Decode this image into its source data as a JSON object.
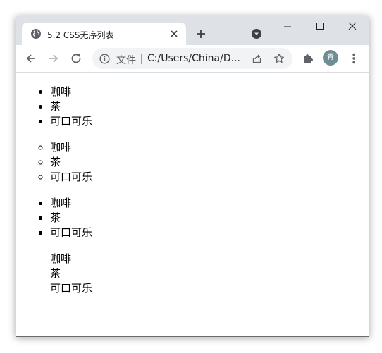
{
  "browser": {
    "tab": {
      "favicon": "globe-icon",
      "title": "5.2 CSS无序列表",
      "close_icon": "close-icon"
    },
    "new_tab_icon": "plus-icon",
    "tab_search_icon": "chevron-down-icon",
    "window_controls": [
      "minimize-icon",
      "maximize-icon",
      "close-icon"
    ],
    "toolbar": {
      "back_icon": "arrow-left-icon",
      "forward_icon": "arrow-right-icon",
      "reload_icon": "reload-icon",
      "site_info_icon": "info-icon",
      "site_label": "文件",
      "url": "C:/Users/China/D...",
      "share_icon": "share-icon",
      "bookmark_icon": "star-icon",
      "extensions_icon": "puzzle-icon",
      "profile_avatar": "青",
      "menu_icon": "kebab-menu-icon"
    }
  },
  "page": {
    "lists": [
      {
        "style": "disc",
        "items": [
          "咖啡",
          "茶",
          "可口可乐"
        ]
      },
      {
        "style": "circle",
        "items": [
          "咖啡",
          "茶",
          "可口可乐"
        ]
      },
      {
        "style": "square",
        "items": [
          "咖啡",
          "茶",
          "可口可乐"
        ]
      },
      {
        "style": "none",
        "items": [
          "咖啡",
          "茶",
          "可口可乐"
        ]
      }
    ]
  },
  "colors": {
    "tabbar_bg": "#dee1e6",
    "omnibox_bg": "#f1f3f4",
    "avatar_bg": "#6f8d95",
    "icon_gray": "#5f6368"
  }
}
